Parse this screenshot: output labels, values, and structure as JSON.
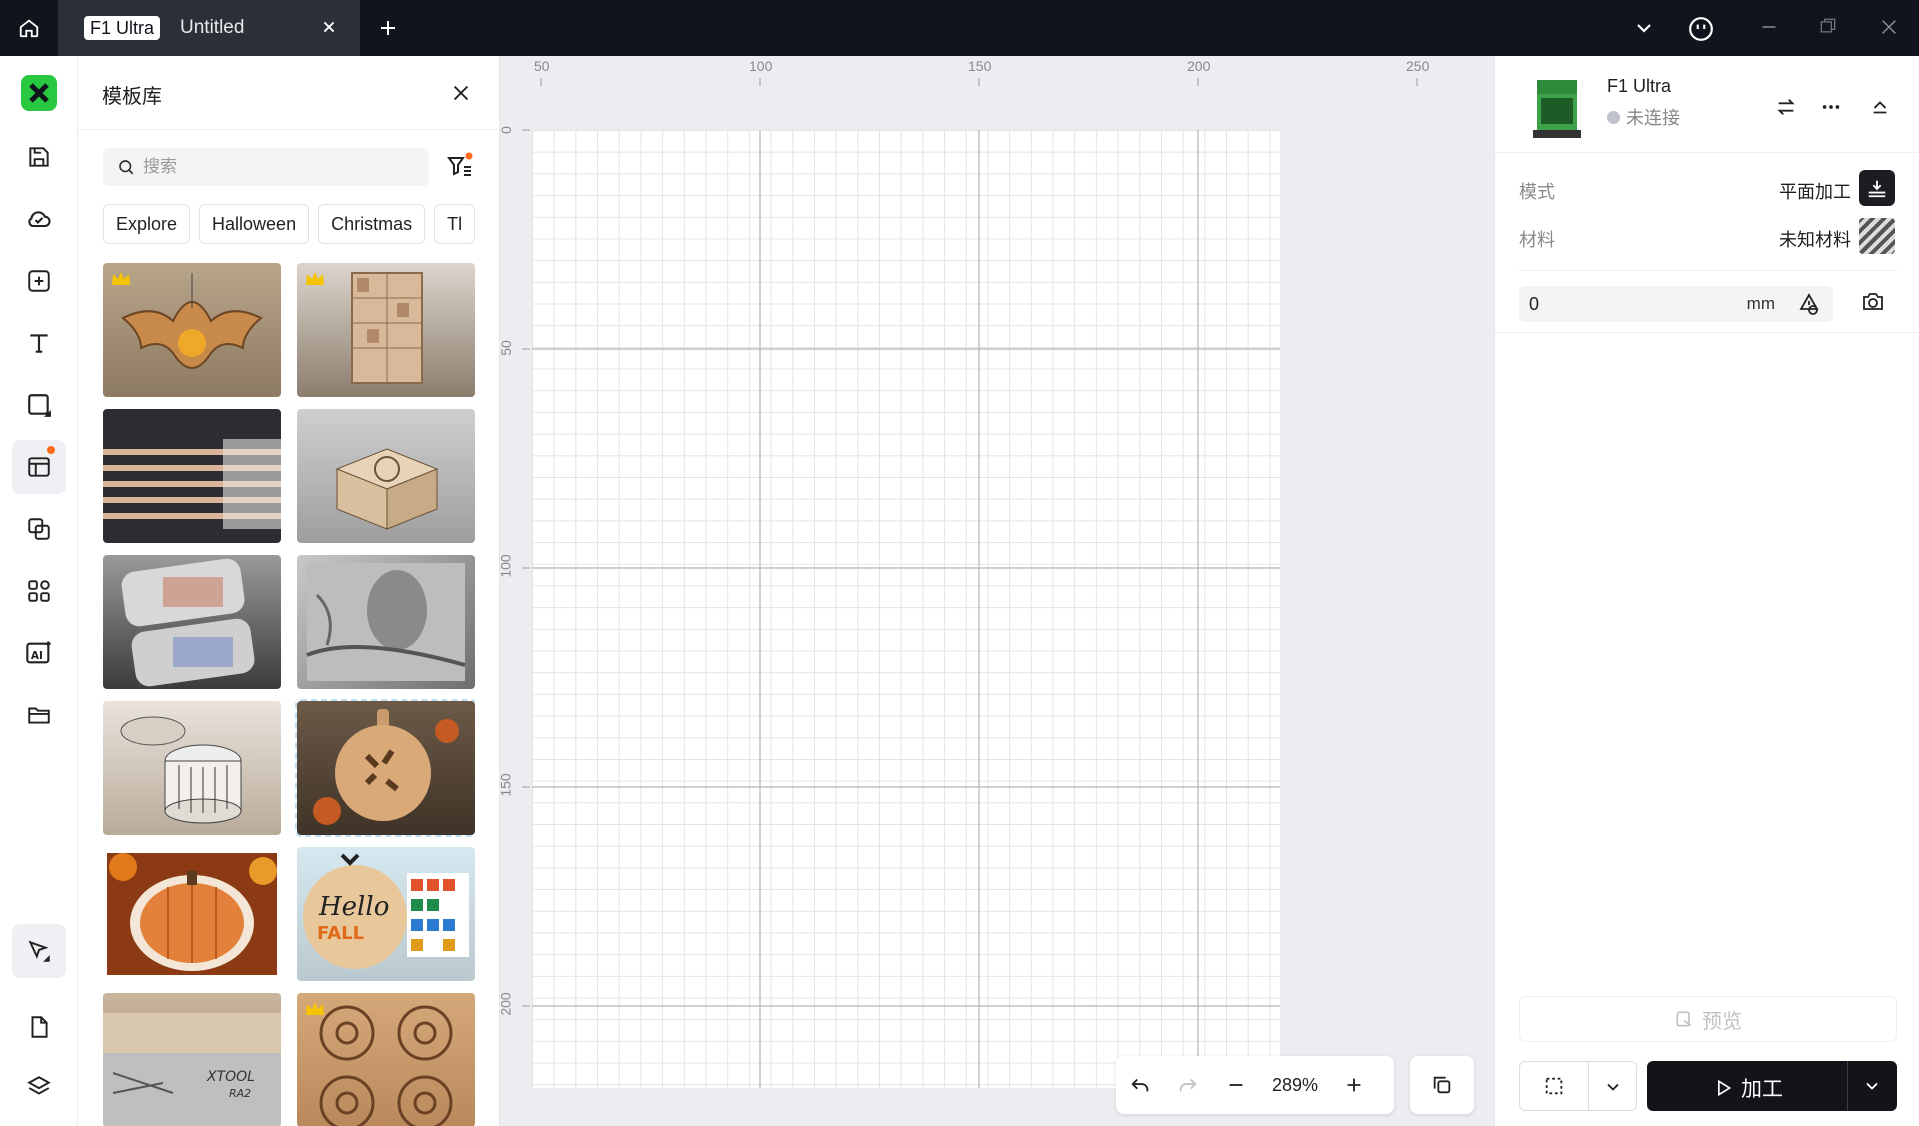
{
  "titlebar": {
    "tab_badge": "F1 Ultra",
    "tab_title": "Untitled"
  },
  "panel": {
    "title": "模板库",
    "search_placeholder": "搜索",
    "chips": [
      "Explore",
      "Halloween",
      "Christmas",
      "Tl"
    ],
    "thumbnails": [
      {
        "subject": "bat ornament",
        "crown": true
      },
      {
        "subject": "earring display stand",
        "crown": true
      },
      {
        "subject": "material test strips",
        "crown": false
      },
      {
        "subject": "carved wooden box",
        "crown": false
      },
      {
        "subject": "metal color test tags",
        "crown": false
      },
      {
        "subject": "engraved eagle relief",
        "crown": false
      },
      {
        "subject": "round wooden container",
        "crown": false
      },
      {
        "subject": "cutting board with leaves",
        "crown": false
      },
      {
        "subject": "pumpkin layered decor",
        "crown": false
      },
      {
        "subject": "hello fall sign",
        "crown": false
      },
      {
        "subject": "xtool box",
        "crown": false
      },
      {
        "subject": "floral coasters",
        "crown": true
      }
    ]
  },
  "canvas": {
    "ruler_top": [
      "50",
      "100",
      "150",
      "200",
      "250"
    ],
    "ruler_left": [
      "0",
      "50",
      "100",
      "150",
      "200"
    ],
    "zoom": "289%"
  },
  "device": {
    "name": "F1 Ultra",
    "status": "未连接",
    "mode_label": "模式",
    "mode_value": "平面加工",
    "material_label": "材料",
    "material_value": "未知材料",
    "height_value": "0",
    "height_unit": "mm",
    "preview_label": "预览",
    "process_label": "加工"
  },
  "colors": {
    "titlebar_bg": "#10141c",
    "accent_green": "#28c840",
    "notify_dot": "#ff6a1a",
    "process_bg": "#12141a"
  }
}
